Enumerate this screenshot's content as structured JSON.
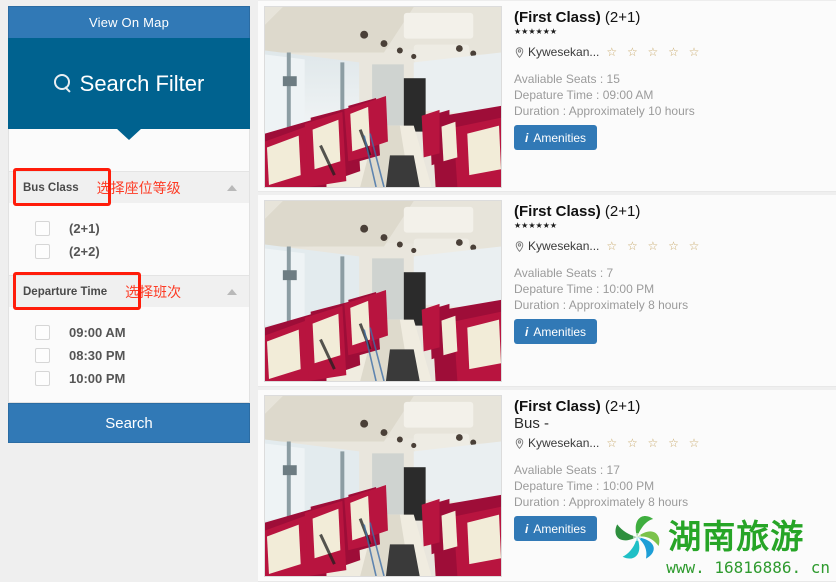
{
  "sidebar": {
    "view_on_map": "View On Map",
    "filter_title": "Search Filter",
    "search_icon": "search-icon",
    "sections": [
      {
        "title": "Bus Class",
        "annotation": "选择座位等级",
        "options": [
          {
            "label": "(2+1)",
            "checked": false
          },
          {
            "label": "(2+2)",
            "checked": false
          }
        ]
      },
      {
        "title": "Departure Time",
        "annotation": "选择班次",
        "options": [
          {
            "label": "09:00 AM",
            "checked": false
          },
          {
            "label": "08:30 PM",
            "checked": false
          },
          {
            "label": "10:00 PM",
            "checked": false
          }
        ]
      }
    ],
    "search_button": "Search"
  },
  "results": [
    {
      "title_bold": "(First Class)",
      "title_class": "(2+1)",
      "subtitle": "",
      "mini_stars": "★★★★★★",
      "location": "Kywesekan...",
      "rating_stars": "☆ ☆ ☆ ☆ ☆",
      "seats_label": "Avaliable Seats :",
      "seats_value": "15",
      "departure_label": "Depature Time :",
      "departure_value": "09:00 AM",
      "duration_label": "Duration :",
      "duration_value": "Approximately 10 hours",
      "amenities_label": "Amenities"
    },
    {
      "title_bold": "(First Class)",
      "title_class": "(2+1)",
      "subtitle": "",
      "mini_stars": "★★★★★★",
      "location": "Kywesekan...",
      "rating_stars": "☆ ☆ ☆ ☆ ☆",
      "seats_label": "Avaliable Seats :",
      "seats_value": "7",
      "departure_label": "Depature Time :",
      "departure_value": "10:00 PM",
      "duration_label": "Duration :",
      "duration_value": "Approximately 8 hours",
      "amenities_label": "Amenities"
    },
    {
      "title_bold": "(First Class)",
      "title_class": "(2+1)",
      "subtitle": "Bus -",
      "mini_stars": "",
      "location": "Kywesekan...",
      "rating_stars": "☆ ☆ ☆ ☆ ☆",
      "seats_label": "Avaliable Seats :",
      "seats_value": "17",
      "departure_label": "Depature Time :",
      "departure_value": "10:00 PM",
      "duration_label": "Duration :",
      "duration_value": "Approximately 8 hours",
      "amenities_label": "Amenities"
    }
  ],
  "watermark": {
    "brand_cn": "湖南旅游",
    "url": "www. 16816886. cn"
  },
  "colors": {
    "primary_blue": "#3179b6",
    "dark_blue": "#00628f",
    "annotation_red": "#fd3b25",
    "highlight_red": "#ff1c0a",
    "watermark_green": "#27a527"
  }
}
